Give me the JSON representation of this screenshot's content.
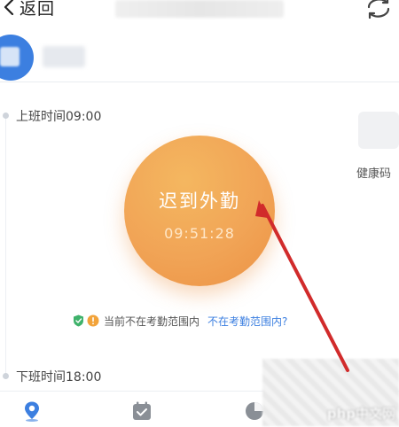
{
  "header": {
    "back_label": "返回",
    "back_icon": "chevron-left-icon",
    "switch_icon": "switch-account-icon"
  },
  "attendance": {
    "health_code_label": "健康码",
    "start_shift": {
      "label": "上班时间09:00"
    },
    "punch_button": {
      "status_label": "迟到外勤",
      "current_time": "09:51:28"
    },
    "range_notice": {
      "message": "当前不在考勤范围内",
      "link_text": "不在考勤范围内",
      "link_suffix": "?"
    },
    "end_shift": {
      "label": "下班时间18:00"
    }
  },
  "tabs": [
    {
      "name": "punch",
      "icon": "location-pin-icon"
    },
    {
      "name": "statistics",
      "icon": "calendar-check-icon"
    },
    {
      "name": "settings",
      "icon": "pie-chart-icon"
    }
  ],
  "watermark": {
    "text": "php中文网"
  },
  "colors": {
    "accent": "#3c7fe0",
    "punch_orange": "#f1a456",
    "warning": "#f2a33a",
    "shield_green": "#3fb26b",
    "annotation_red": "#d12b2b"
  }
}
